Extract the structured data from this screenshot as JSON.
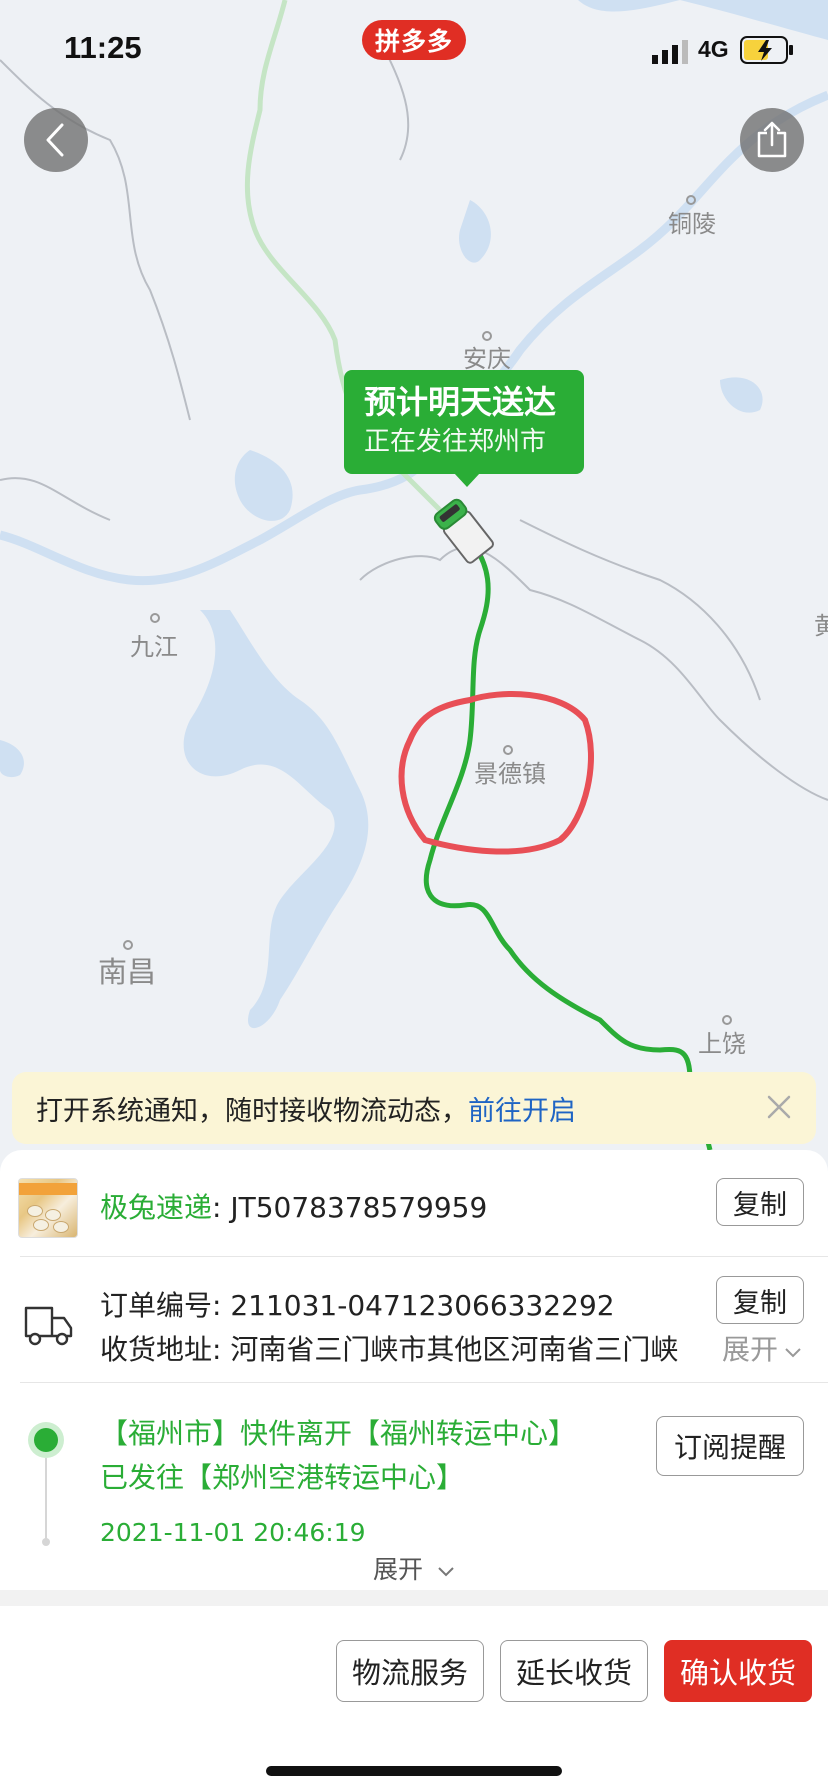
{
  "status_bar": {
    "time": "11:25",
    "network": "4G",
    "app_badge": "拼多多"
  },
  "map": {
    "cities": [
      "铜陵",
      "安庆",
      "九江",
      "景德镇",
      "南昌",
      "上饶",
      "黄"
    ],
    "route_color": "#2aad36",
    "annotation_color": "#e84f56"
  },
  "eta": {
    "title": "预计明天送达",
    "subtitle": "正在发往郑州市"
  },
  "notice": {
    "text": "打开系统通知，随时接收物流动态，",
    "link": "前往开启"
  },
  "carrier": {
    "name": "极兔速递",
    "separator": ": ",
    "tracking_no": "JT5078378579959",
    "copy_label": "复制"
  },
  "order": {
    "number_label": "订单编号",
    "number": "211031-047123066332292",
    "address_label": "收货地址",
    "address": "河南省三门峡市其他区河南省三门峡",
    "copy_label": "复制",
    "expand_label": "展开"
  },
  "tracking": {
    "line1": "【福州市】快件离开【福州转运中心】",
    "line2": "已发往【郑州空港转运中心】",
    "time": "2021-11-01 20:46:19",
    "subscribe_label": "订阅提醒",
    "expand_label": "展开"
  },
  "footer": {
    "logistics_service": "物流服务",
    "extend_receipt": "延长收货",
    "confirm_receipt": "确认收货"
  },
  "colors": {
    "brand_red": "#e02e24",
    "green": "#2aad36",
    "link_blue": "#1f64c4"
  }
}
